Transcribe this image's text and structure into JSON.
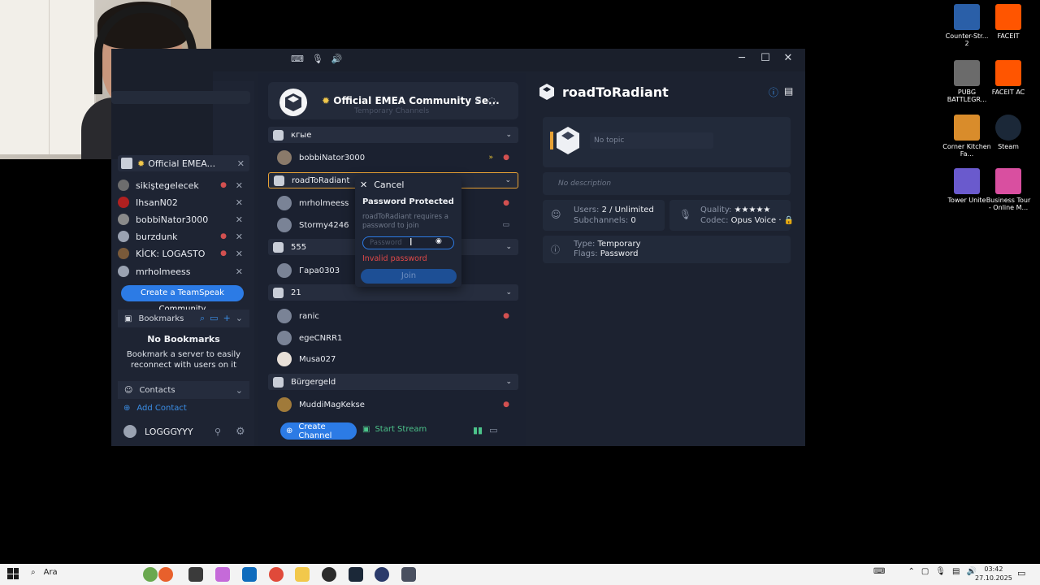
{
  "window": {
    "minimize": "─",
    "maximize": "☐",
    "close": "✕"
  },
  "sidebar": {
    "server_tab": "Official EMEA...",
    "users": [
      {
        "name": "sikiştegelecek",
        "color": "#6d6d6d"
      },
      {
        "name": "IhsanN02",
        "color": "#b02020"
      },
      {
        "name": "bobbiNator3000",
        "color": "#8a8a8a"
      },
      {
        "name": "burzdunk",
        "color": "#9aa2b1"
      },
      {
        "name": "KİCK: LOGASTO",
        "color": "#7a5a3a"
      },
      {
        "name": "mrholmeess",
        "color": "#9aa2b1"
      }
    ],
    "create_community": "Create a TeamSpeak Community",
    "bookmarks_label": "Bookmarks",
    "no_bookmarks_title": "No Bookmarks",
    "no_bookmarks_text": "Bookmark a server to easily reconnect with users on it",
    "contacts_label": "Contacts",
    "add_contact": "Add Contact",
    "username": "LOGGGYYY"
  },
  "server": {
    "name": "Official EMEA Community Se...",
    "subtitle": "Temporary Channels"
  },
  "channels": {
    "c1": "кгые",
    "c1_user": "bobbiNator3000",
    "c2": "roadToRadiant",
    "c2_users": [
      "mrholmeess",
      "Stormy4246"
    ],
    "c3": "555",
    "c3_user": "Гара0303",
    "c4": "21",
    "c4_users": [
      "ranic",
      "egeCNRR1",
      "Musa027"
    ],
    "c5": "Bürgergeld",
    "c5_user": "MuddiMagKekse"
  },
  "bottom": {
    "create_channel": "Create Channel",
    "start_stream": "Start Stream"
  },
  "popup": {
    "cancel": "Cancel",
    "title": "Password Protected",
    "desc": "roadToRadiant requires a password to join",
    "placeholder": "Password",
    "error": "Invalid password",
    "join": "Join"
  },
  "channel_info": {
    "title": "roadToRadiant",
    "topic": "No topic",
    "description": "No description",
    "users_label": "Users:",
    "users_value": "2 / Unlimited",
    "subchannels_label": "Subchannels:",
    "subchannels_value": "0",
    "quality_label": "Quality:",
    "quality_value": "★★★★★",
    "codec_label": "Codec:",
    "codec_value": "Opus Voice",
    "type_label": "Type:",
    "type_value": "Temporary",
    "flags_label": "Flags:",
    "flags_value": "Password"
  },
  "desktop_icons": [
    {
      "label": "Counter-Str... 2",
      "color": "#2a5fa8"
    },
    {
      "label": "FACEIT",
      "color": "#ff5500"
    },
    {
      "label": "PUBG BATTLEGR...",
      "color": "#6b6b6b"
    },
    {
      "label": "FACEIT AC",
      "color": "#ff5500"
    },
    {
      "label": "Corner Kitchen Fa...",
      "color": "#d98c2b"
    },
    {
      "label": "Steam",
      "color": "#1b2838"
    },
    {
      "label": "Tower Unite",
      "color": "#6a5acd"
    },
    {
      "label": "Business Tour - Online M...",
      "color": "#d94fa0"
    }
  ],
  "taskbar": {
    "search": "Ara",
    "time": "03:42",
    "date": "27.10.2025"
  }
}
